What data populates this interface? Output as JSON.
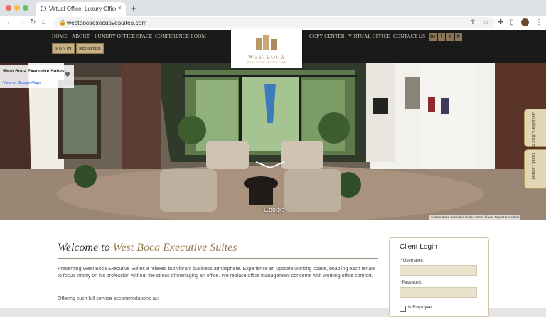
{
  "browser": {
    "tab_title": "Virtual Office, Luxury Office, M",
    "tab_close": "×",
    "new_tab": "+",
    "url": "westbocaexecutivesuites.com",
    "nav_icons": {
      "back": "←",
      "forward": "→",
      "reload": "↻",
      "home": "⌂"
    },
    "lock_icon": "🔒",
    "toolbar_icons": {
      "share": "⇧",
      "bookmark": "☆",
      "extensions": "✚",
      "sidepanel": "▯",
      "menu": "⋮"
    }
  },
  "site": {
    "nav_left": [
      "HOME",
      "ABOUT",
      "LUXURY OFFICE SPACE",
      "CONFERENCE ROOM"
    ],
    "nav_right": [
      "COPY CENTER",
      "VIRTUAL OFFICE",
      "CONTACT US"
    ],
    "sign_in": "SIGN IN",
    "register": "REGISTER",
    "logo_name": "WESTBOCA",
    "logo_sub": "EXECUTIVE SUITES.COM",
    "social": [
      "G+",
      "f",
      "t",
      "P"
    ]
  },
  "streetview": {
    "place_name": "West Boca Executive Suites",
    "maps_link": "View on Google Maps",
    "google_label": "Google",
    "attribution": "© West Boca Executive Suites    Terms of Use    Report a problem",
    "zoom_in": "+",
    "zoom_out": "−"
  },
  "side_tabs": {
    "available": "Available Office Space",
    "quick": "Quick Contact"
  },
  "main": {
    "welcome_prefix": "Welcome to ",
    "welcome_accent": "West Boca Executive Suites",
    "intro": "Presenting West Boca Executive Suites a relaxed but vibrant business atmosphere. Experience an upscale working space, enabling each tenant to focus strictly on his profession without the stress of managing an office. We replace office management concerns with working office comfort.",
    "offering": "Offering such full service accommodations as:"
  },
  "login": {
    "title": "Client Login",
    "username_label": "Username:",
    "password_label": "Password:",
    "required_mark": "*",
    "employee_label": "Is Employee"
  },
  "colors": {
    "brand_gold": "#c7b184",
    "header_bg": "#1a1a1a",
    "accent_text": "#9a7b4f"
  }
}
